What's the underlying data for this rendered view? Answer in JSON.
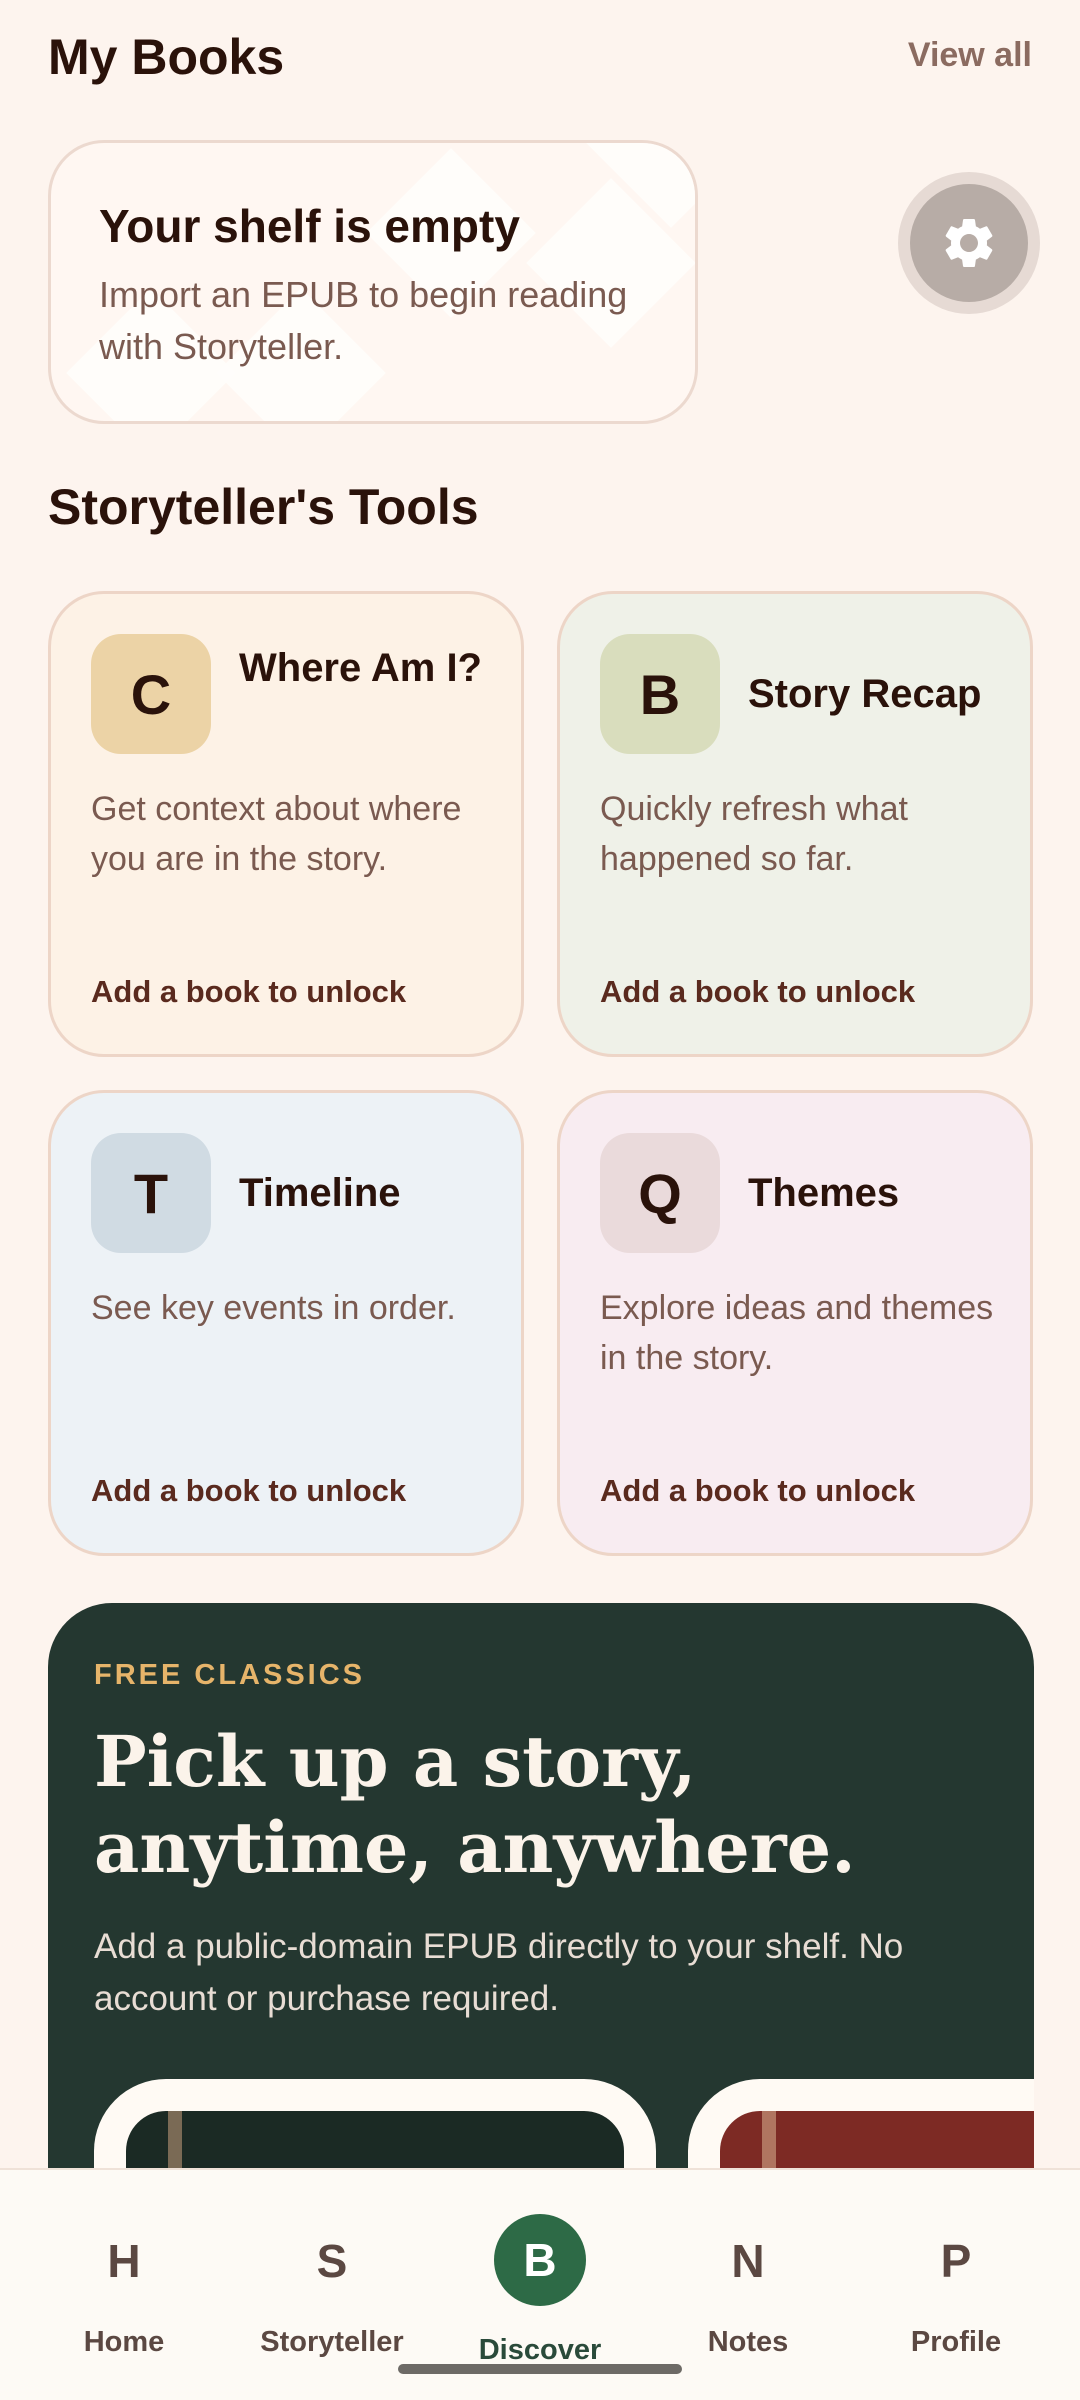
{
  "header": {
    "title": "My Books",
    "view_all": "View all"
  },
  "empty_shelf": {
    "title": "Your shelf is empty",
    "subtitle": "Import an EPUB to begin reading with Storyteller."
  },
  "settings": {
    "icon": "gear-icon"
  },
  "tools": {
    "section_title": "Storyteller's Tools",
    "items": [
      {
        "badge": "C",
        "name": "Where Am I?",
        "description": "Get context about where you are in the story.",
        "cta": "Add a book to unlock"
      },
      {
        "badge": "B",
        "name": "Story Recap",
        "description": "Quickly refresh what happened so far.",
        "cta": "Add a book to unlock"
      },
      {
        "badge": "T",
        "name": "Timeline",
        "description": "See key events in order.",
        "cta": "Add a book to unlock"
      },
      {
        "badge": "Q",
        "name": "Themes",
        "description": "Explore ideas and themes in the story.",
        "cta": "Add a book to unlock"
      }
    ]
  },
  "classics": {
    "kicker": "FREE CLASSICS",
    "title": "Pick up a story, anytime, anywhere.",
    "subtitle": "Add a public-domain EPUB directly to your shelf. No account or purchase required."
  },
  "nav": {
    "items": [
      {
        "letter": "H",
        "label": "Home"
      },
      {
        "letter": "S",
        "label": "Storyteller"
      },
      {
        "letter": "B",
        "label": "Discover",
        "active": true
      },
      {
        "letter": "N",
        "label": "Notes"
      },
      {
        "letter": "P",
        "label": "Profile"
      }
    ]
  },
  "colors": {
    "background": "#fdf4ee",
    "accent_green": "#2d6a46",
    "banner_dark": "#243730",
    "kicker_gold": "#e6b46a"
  }
}
